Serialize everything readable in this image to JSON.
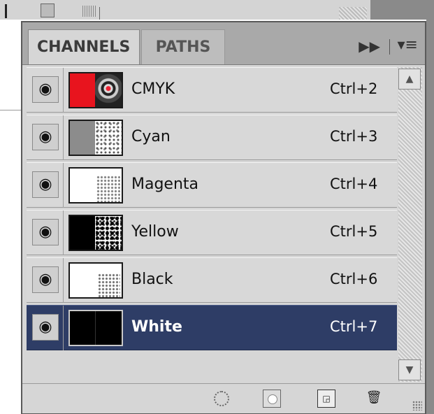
{
  "tabs": [
    {
      "label": "CHANNELS",
      "active": true
    },
    {
      "label": "PATHS",
      "active": false
    }
  ],
  "channels": [
    {
      "name": "CMYK",
      "shortcut": "Ctrl+2",
      "selected": false,
      "thumb": "cmyk"
    },
    {
      "name": "Cyan",
      "shortcut": "Ctrl+3",
      "selected": false,
      "thumb": "cyan"
    },
    {
      "name": "Magenta",
      "shortcut": "Ctrl+4",
      "selected": false,
      "thumb": "magenta"
    },
    {
      "name": "Yellow",
      "shortcut": "Ctrl+5",
      "selected": false,
      "thumb": "yellow"
    },
    {
      "name": "Black",
      "shortcut": "Ctrl+6",
      "selected": false,
      "thumb": "black"
    },
    {
      "name": "White",
      "shortcut": "Ctrl+7",
      "selected": true,
      "thumb": "white"
    }
  ],
  "icons": {
    "visibility": "eye-icon",
    "flyout": "double-arrow-icon",
    "panel_menu": "panel-menu-icon",
    "toolbar": [
      "load-selection-icon",
      "save-selection-mask-icon",
      "new-channel-icon",
      "trash-icon"
    ]
  },
  "colors": {
    "selected_row": "#2e3d66",
    "panel_bg": "#d6d6d6",
    "tab_bar": "#a9a9a9"
  }
}
